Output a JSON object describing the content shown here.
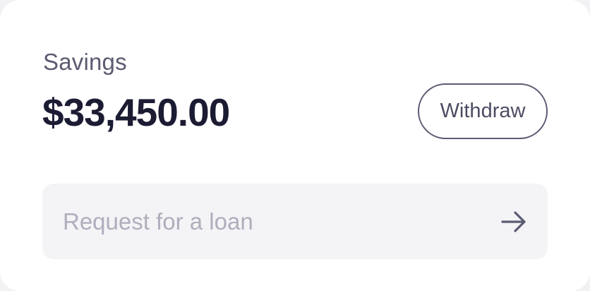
{
  "savings": {
    "label": "Savings",
    "balance": "$33,450.00",
    "withdraw_label": "Withdraw"
  },
  "loan": {
    "label": "Request for a loan",
    "icon": "arrow-right-icon"
  },
  "colors": {
    "primary_text": "#1b1b33",
    "secondary_text": "#5b5b72",
    "muted_text": "#aeaebd",
    "field_background": "#f4f4f7"
  }
}
